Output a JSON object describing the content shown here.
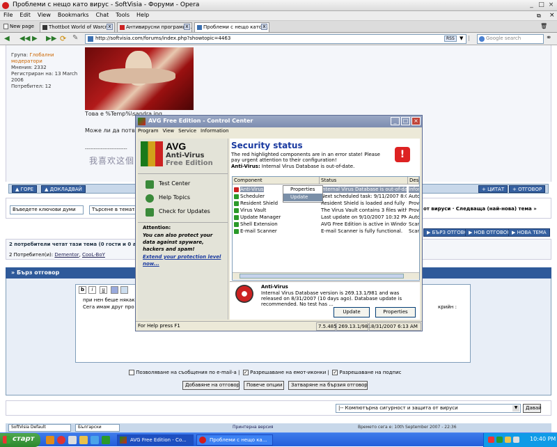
{
  "browser": {
    "title": "Проблеми с нещо като вирус - SoftVisia - Форуми - Opera",
    "menu": [
      "File",
      "Edit",
      "View",
      "Bookmarks",
      "Chat",
      "Tools",
      "Help"
    ],
    "tabs": [
      {
        "label": "New page"
      },
      {
        "label": "Thottbot World of Warcr..."
      },
      {
        "label": "Антивирусни програми ..."
      },
      {
        "label": "Проблеми с нещо като ..."
      }
    ],
    "address": "http://softvisia.com/forums/index.php?showtopic=4463",
    "search_placeholder": "Google search",
    "rss_label": "RSS"
  },
  "post": {
    "group_label": "Група:",
    "group_value": "Глобални модератори",
    "posts": "Мнения: 2332",
    "registered": "Регистриран на: 13 March 2006",
    "user_no": "Потребител: 12",
    "line1": "Това е %Temp%\\sandra.jpg",
    "line2": "Може ли да потвърдите",
    "signature": "我喜欢这個中"
  },
  "forum": {
    "top_btn": "ГОРЕ",
    "quote_btn": "ДОКЛАДВАЙ",
    "cite_btn": "ЦИТАТ",
    "reply_btn": "ОТГОВОР",
    "search_input": "Въведете ключови думи",
    "search_select": "Търсене в темата",
    "nav_text": "от вируси · Следваща (най-нова) тема »",
    "fast_reply_btn": "БЪРЗ ОТГОВОР",
    "new_reply_btn": "НОВ ОТГОВОР",
    "new_topic_btn": "НОВА ТЕМА",
    "readers_header": "2 потребители четат тази тема (0 гости и 0 а",
    "readers_label": "2 Потребител(и):",
    "reader1": "Dementor",
    "reader2": "CooL-BoY",
    "quick_reply_title": "Бърз отговор",
    "editor_text1": "при нен беше някак",
    "editor_text2": "Сега имам друг про",
    "editor_text3": "крийн :",
    "opt1": "Позволяване на съобщения по e-mail-а |",
    "opt2": "Разрешаване на емот-иконки |",
    "opt3": "Разрешаване на подпис",
    "submit_btn": "Добавяне на отговор",
    "more_btn": "Повече опции",
    "close_btn": "Затваряне на бързия отговор",
    "jump_select": "|-- Компютърна сигурност и защита от вируси",
    "go_btn": "Давай",
    "skin_select": "SoftVisia Default",
    "lang_select": "Български",
    "print_link": "Принтерна версия",
    "time_text": "Времето сега е: 10th September 2007 - 22:36"
  },
  "avg": {
    "title": "AVG Free Edition - Control Center",
    "menu": [
      "Program",
      "View",
      "Service",
      "Information"
    ],
    "logo_brand": "AVG",
    "logo_line1": "Anti-Virus",
    "logo_line2": "Free Edition",
    "nav": [
      "Test Center",
      "Help Topics",
      "Check for Updates"
    ],
    "attention_title": "Attention:",
    "attention_text": "You can also protect your data against spyware, hackers and spam!",
    "extend_link": "Extend your protection level now...",
    "security_title": "Security status",
    "security_text": "The red highlighted components are in an error state! Please pay urgent attention to their configuration!",
    "security_detail_label": "Anti-Virus:",
    "security_detail": "Internal Virus Database is out-of-date.",
    "columns": [
      "Component",
      "Status",
      "Desc"
    ],
    "rows": [
      {
        "component": "Anti-Virus",
        "status": "Internal Virus Database is out-of-date.",
        "desc": "Infor",
        "error": true
      },
      {
        "component": "Scheduler",
        "status": "Next scheduled task: 9/11/2007 8:0...",
        "desc": "Autom",
        "error": false
      },
      {
        "component": "Resident Shield",
        "status": "Resident Shield is loaded and fully fu...",
        "desc": "Provi",
        "error": false
      },
      {
        "component": "Virus Vault",
        "status": "The Virus Vault contains 3 files with ...",
        "desc": "Provi",
        "error": false
      },
      {
        "component": "Update Manager",
        "status": "Last update on 9/10/2007 10:32 PM ...",
        "desc": "Autom",
        "error": false
      },
      {
        "component": "Shell Extension",
        "status": "AVG Free Edition is active in Window...",
        "desc": "Scan",
        "error": false
      },
      {
        "component": "E-mail Scanner",
        "status": "E-mail Scanner is fully functional.",
        "desc": "Scan",
        "error": false
      }
    ],
    "context_menu": [
      "Properties",
      "Update"
    ],
    "detail_title": "Anti-Virus",
    "detail_text": "Internal Virus Database version is 269.13.1/981 and was released on 8/31/2007 (10 days ago). Database update is recommended. No test has ...",
    "update_btn": "Update",
    "properties_btn": "Properties",
    "status_help": "For Help press F1",
    "status_ver": "7.5.485",
    "status_db": "269.13.1/981",
    "status_date": "8/31/2007 6:13 AM"
  },
  "taskbar": {
    "start": "старт",
    "tasks": [
      "AVG Free Edition - Co...",
      "Проблеми с нещо ка..."
    ],
    "clock": "10:40 PM"
  }
}
